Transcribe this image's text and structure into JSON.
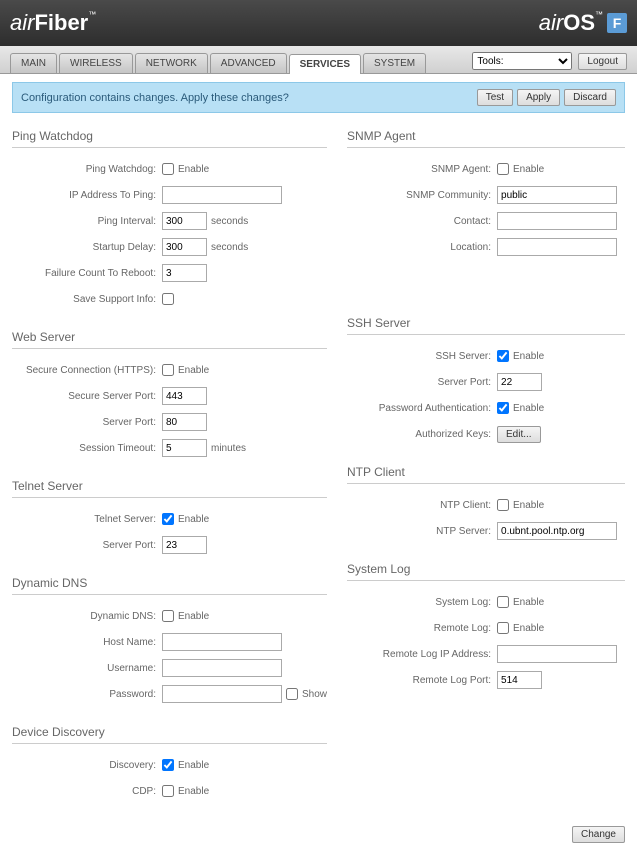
{
  "header": {
    "brand_left_pre": "air",
    "brand_left_post": "Fiber",
    "brand_right_pre": "air",
    "brand_right_post": "OS",
    "f_badge": "F",
    "tm": "™"
  },
  "tabbar": {
    "tabs": [
      "MAIN",
      "WIRELESS",
      "NETWORK",
      "ADVANCED",
      "SERVICES",
      "SYSTEM"
    ],
    "active_index": 4,
    "tools_label": "Tools:",
    "logout": "Logout"
  },
  "alert": {
    "message": "Configuration contains changes. Apply these changes?",
    "test": "Test",
    "apply": "Apply",
    "discard": "Discard"
  },
  "sections": {
    "ping_watchdog": {
      "title": "Ping Watchdog",
      "fields": {
        "watchdog_label": "Ping Watchdog:",
        "enable": "Enable",
        "ip_label": "IP Address To Ping:",
        "ip_val": "",
        "interval_label": "Ping Interval:",
        "interval_val": "300",
        "interval_unit": "seconds",
        "delay_label": "Startup Delay:",
        "delay_val": "300",
        "delay_unit": "seconds",
        "failcount_label": "Failure Count To Reboot:",
        "failcount_val": "3",
        "savesupport_label": "Save Support Info:"
      }
    },
    "snmp": {
      "title": "SNMP Agent",
      "fields": {
        "agent_label": "SNMP Agent:",
        "enable": "Enable",
        "community_label": "SNMP Community:",
        "community_val": "public",
        "contact_label": "Contact:",
        "contact_val": "",
        "location_label": "Location:",
        "location_val": ""
      }
    },
    "web": {
      "title": "Web Server",
      "fields": {
        "https_label": "Secure Connection (HTTPS):",
        "enable": "Enable",
        "sport_label": "Secure Server Port:",
        "sport_val": "443",
        "port_label": "Server Port:",
        "port_val": "80",
        "timeout_label": "Session Timeout:",
        "timeout_val": "5",
        "timeout_unit": "minutes"
      }
    },
    "ssh": {
      "title": "SSH Server",
      "fields": {
        "server_label": "SSH Server:",
        "enable": "Enable",
        "port_label": "Server Port:",
        "port_val": "22",
        "pwauth_label": "Password Authentication:",
        "keys_label": "Authorized Keys:",
        "edit_btn": "Edit..."
      }
    },
    "telnet": {
      "title": "Telnet Server",
      "fields": {
        "server_label": "Telnet Server:",
        "enable": "Enable",
        "port_label": "Server Port:",
        "port_val": "23"
      }
    },
    "ntp": {
      "title": "NTP Client",
      "fields": {
        "client_label": "NTP Client:",
        "enable": "Enable",
        "server_label": "NTP Server:",
        "server_val": "0.ubnt.pool.ntp.org"
      }
    },
    "ddns": {
      "title": "Dynamic DNS",
      "fields": {
        "ddns_label": "Dynamic DNS:",
        "enable": "Enable",
        "host_label": "Host Name:",
        "host_val": "",
        "user_label": "Username:",
        "user_val": "",
        "pass_label": "Password:",
        "pass_val": "",
        "show": "Show"
      }
    },
    "syslog": {
      "title": "System Log",
      "fields": {
        "syslog_label": "System Log:",
        "enable": "Enable",
        "remote_label": "Remote Log:",
        "ip_label": "Remote Log IP Address:",
        "ip_val": "",
        "port_label": "Remote Log Port:",
        "port_val": "514"
      }
    },
    "discovery": {
      "title": "Device Discovery",
      "fields": {
        "disc_label": "Discovery:",
        "enable": "Enable",
        "cdp_label": "CDP:"
      }
    }
  },
  "footer": {
    "change": "Change"
  }
}
